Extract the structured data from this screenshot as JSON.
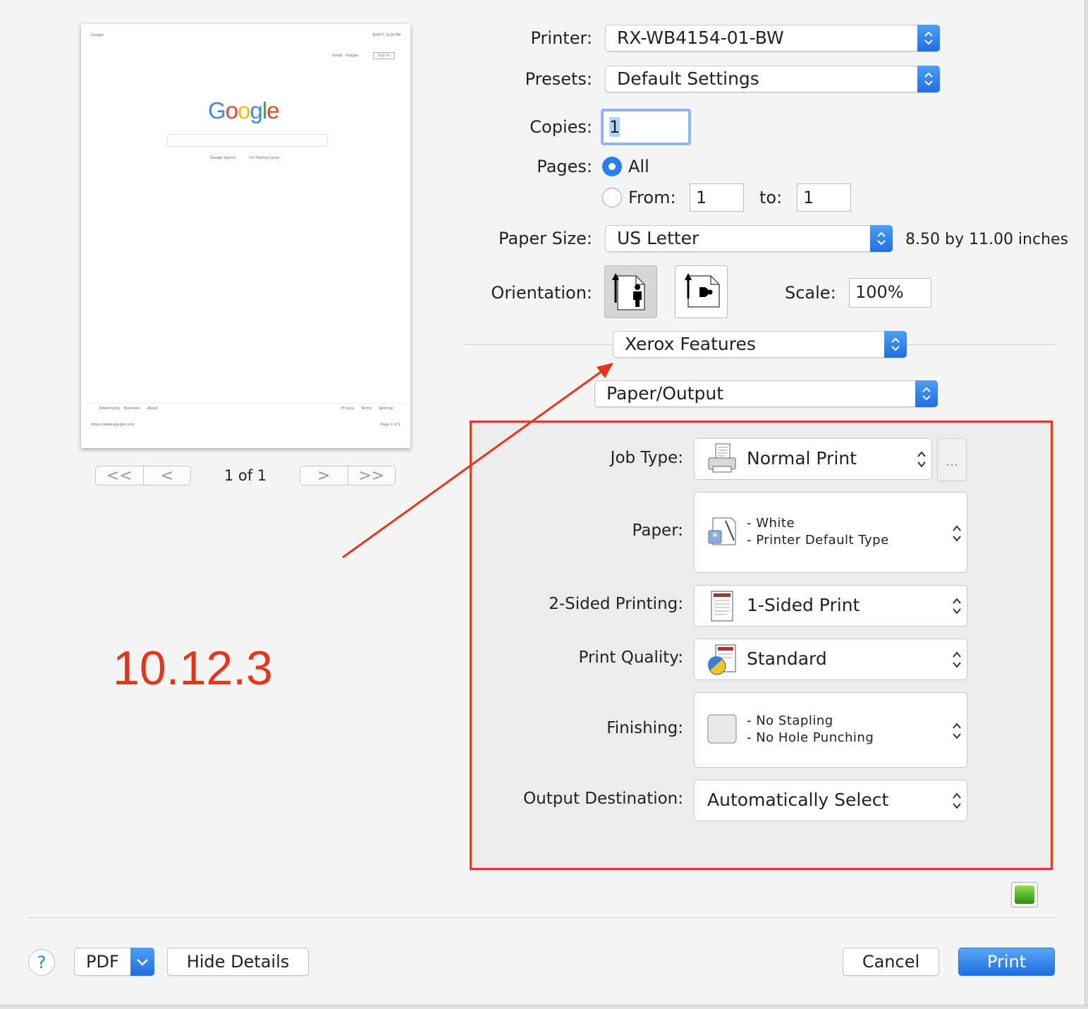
{
  "preview": {
    "header_left": "Google",
    "header_right": "8/9/17, 4:20 PM",
    "top_links": [
      "Gmail",
      "Images"
    ],
    "sign_in": "Sign in",
    "logo_letters": [
      "G",
      "o",
      "o",
      "g",
      "l",
      "e"
    ],
    "buttons": [
      "Google Search",
      "I'm Feeling Lucky"
    ],
    "footer_left": [
      "Advertising",
      "Business",
      "About"
    ],
    "footer_right": [
      "Privacy",
      "Terms",
      "Settings"
    ],
    "url": "https://www.google.com/",
    "page_label": "Page 1 of 1",
    "nav_first": "<<",
    "nav_prev": "<",
    "nav_next": ">",
    "nav_last": ">>",
    "page_count": "1 of 1"
  },
  "printer": {
    "label": "Printer:",
    "value": "RX-WB4154-01-BW"
  },
  "presets": {
    "label": "Presets:",
    "value": "Default Settings"
  },
  "copies": {
    "label": "Copies:",
    "value": "1"
  },
  "pages": {
    "label": "Pages:",
    "all_label": "All",
    "from_label": "From:",
    "from_value": "1",
    "to_label": "to:",
    "to_value": "1",
    "selected": "All"
  },
  "paper_size": {
    "label": "Paper Size:",
    "value": "US Letter",
    "dimensions": "8.50 by 11.00 inches"
  },
  "orientation": {
    "label": "Orientation:",
    "selected": "portrait"
  },
  "scale": {
    "label": "Scale:",
    "value": "100%"
  },
  "section_popup": "Xerox Features",
  "subsection_popup": "Paper/Output",
  "xerox": {
    "job_type": {
      "label": "Job Type:",
      "value": "Normal Print",
      "more": "..."
    },
    "paper": {
      "label": "Paper:",
      "line1": "- White",
      "line2": "- Printer Default Type"
    },
    "two_sided": {
      "label": "2-Sided Printing:",
      "value": "1-Sided Print"
    },
    "print_quality": {
      "label": "Print Quality:",
      "value": "Standard"
    },
    "finishing": {
      "label": "Finishing:",
      "line1": "- No Stapling",
      "line2": "- No Hole Punching"
    },
    "output_destination": {
      "label": "Output Destination:",
      "value": "Automatically Select"
    }
  },
  "annotation": {
    "version_text": "10.12.3",
    "color": "#e8341c"
  },
  "footer": {
    "help": "?",
    "pdf": "PDF",
    "hide_details": "Hide Details",
    "cancel": "Cancel",
    "print": "Print"
  },
  "colors": {
    "accent": "#2a7ff0",
    "highlight": "#e8341c"
  }
}
